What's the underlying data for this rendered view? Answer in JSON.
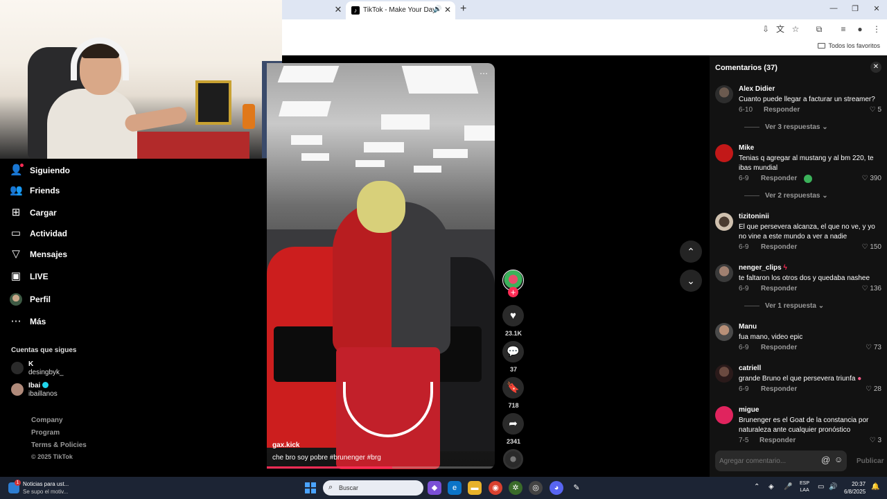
{
  "browser": {
    "tab_title": "TikTok - Make Your Day",
    "bookmarks_all": "Todos los favoritos"
  },
  "sidebar": {
    "items": [
      {
        "label": "Siguiendo",
        "icon": "following-icon"
      },
      {
        "label": "Friends",
        "icon": "friends-icon"
      },
      {
        "label": "Cargar",
        "icon": "upload-icon"
      },
      {
        "label": "Actividad",
        "icon": "activity-icon"
      },
      {
        "label": "Mensajes",
        "icon": "messages-icon"
      },
      {
        "label": "LIVE",
        "icon": "live-icon"
      },
      {
        "label": "Perfil",
        "icon": "profile-avatar"
      },
      {
        "label": "Más",
        "icon": "more-icon"
      }
    ],
    "following_title": "Cuentas que sigues",
    "following": [
      {
        "name": "K",
        "handle": "desingbyk_"
      },
      {
        "name": "Ibai",
        "handle": "ibaillanos"
      }
    ],
    "footer": [
      "Company",
      "Program",
      "Terms & Policies"
    ],
    "copyright": "© 2025 TikTok"
  },
  "video": {
    "author": "gax.kick",
    "caption": "che bro soy pobre #brunenger #brg",
    "progress": 0.55
  },
  "actions": {
    "likes": "23.1K",
    "comments": "37",
    "saves": "718",
    "shares": "2341"
  },
  "comments_panel": {
    "title": "Comentarios (37)",
    "input_placeholder": "Agregar comentario...",
    "post_label": "Publicar",
    "reply_label": "Responder",
    "comments": [
      {
        "user": "Alex Didier",
        "text": "Cuanto puede llegar a facturar un streamer?",
        "date": "6-10",
        "likes": "5",
        "replies": "Ver 3 respuestas"
      },
      {
        "user": "Mike",
        "text": "Tenias q agregar al mustang y al bm 220, te ibas mundial",
        "date": "6-9",
        "likes": "390",
        "replies": "Ver 2 respuestas"
      },
      {
        "user": "tizitoninii",
        "text": "El que persevera alcanza, el que no ve, y yo no vine a este mundo a ver a nadie",
        "date": "6-9",
        "likes": "150",
        "replies": ""
      },
      {
        "user": "nenger_clips",
        "text": "te faltaron los otros dos y quedaba nashee",
        "date": "6-9",
        "likes": "136",
        "replies": "Ver 1 respuesta"
      },
      {
        "user": "Manu",
        "text": "fua mano, video epic",
        "date": "6-9",
        "likes": "73",
        "replies": ""
      },
      {
        "user": "catriell",
        "text": "grande Bruno el que persevera triunfa",
        "date": "6-9",
        "likes": "28",
        "replies": ""
      },
      {
        "user": "migue",
        "text": "Brunenger es el Goat de la constancia por naturaleza ante cualquier pronóstico",
        "date": "7-5",
        "likes": "3",
        "replies": ""
      }
    ]
  },
  "taskbar": {
    "news_title": "Noticias para ust...",
    "news_sub": "Se supo el motiv...",
    "news_badge": "1",
    "search_placeholder": "Buscar",
    "lang_top": "ESP",
    "lang_bottom": "LAA",
    "time": "20:37",
    "date": "6/8/2025"
  }
}
